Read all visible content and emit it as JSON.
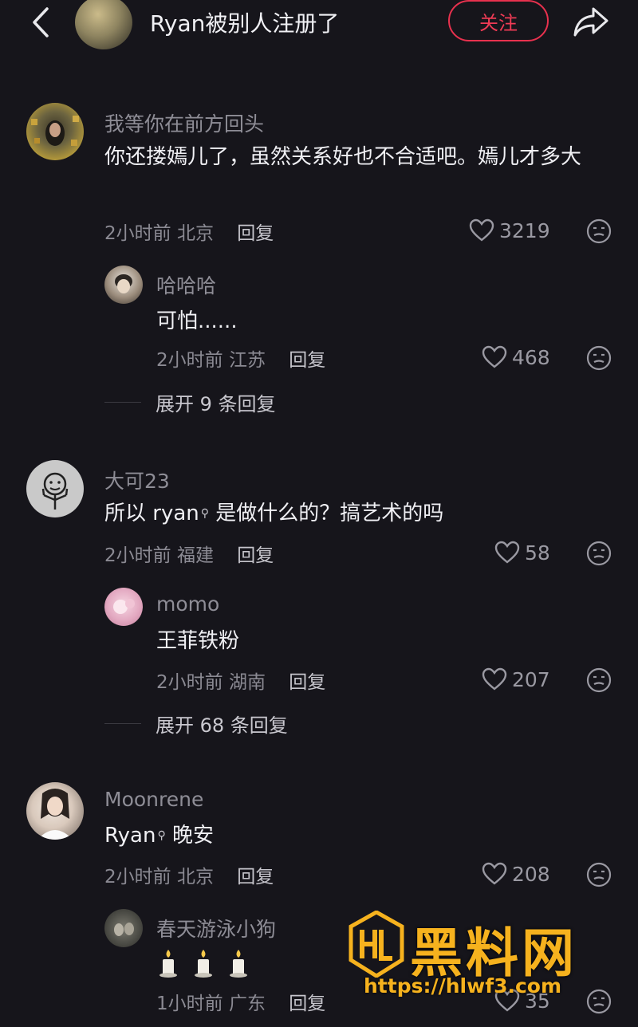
{
  "header": {
    "title": "Ryan被别人注册了",
    "follow_label": "关注"
  },
  "comments": [
    {
      "username": "我等你在前方回头",
      "text": "你还搂嫣儿了，虽然关系好也不合适吧。嫣儿才多大",
      "time": "2小时前",
      "location": "北京",
      "reply_label": "回复",
      "likes": "3219",
      "replies": [
        {
          "username": "哈哈哈",
          "text": "可怕......",
          "time": "2小时前",
          "location": "江苏",
          "reply_label": "回复",
          "likes": "468"
        }
      ],
      "expand_label": "展开 9 条回复"
    },
    {
      "username": "大可23",
      "text_prefix": "所以 ryan",
      "text_suffix": " 是做什么的？搞艺术的吗",
      "time": "2小时前",
      "location": "福建",
      "reply_label": "回复",
      "likes": "58",
      "replies": [
        {
          "username": "momo",
          "text": "王菲铁粉",
          "time": "2小时前",
          "location": "湖南",
          "reply_label": "回复",
          "likes": "207"
        }
      ],
      "expand_label": "展开 68 条回复"
    },
    {
      "username": "Moonrene",
      "text_prefix": "Ryan",
      "text_suffix": " 晚安",
      "time": "2小时前",
      "location": "北京",
      "reply_label": "回复",
      "likes": "208",
      "replies": [
        {
          "username": "春天游泳小狗",
          "text": "🕯🕯🕯",
          "time": "1小时前",
          "location": "广东",
          "reply_label": "回复",
          "likes": "35"
        }
      ]
    }
  ],
  "watermark": {
    "title": "黑料网",
    "url": "https://hlwf3.com",
    "color": "#f6b21e"
  },
  "colors": {
    "background": "#16151b",
    "accent_red": "#e8314e",
    "muted_text": "#8e8d96"
  },
  "icons": [
    "back-arrow-icon",
    "share-icon",
    "heart-icon",
    "emoji-react-icon",
    "search-icon",
    "candle-icon"
  ]
}
